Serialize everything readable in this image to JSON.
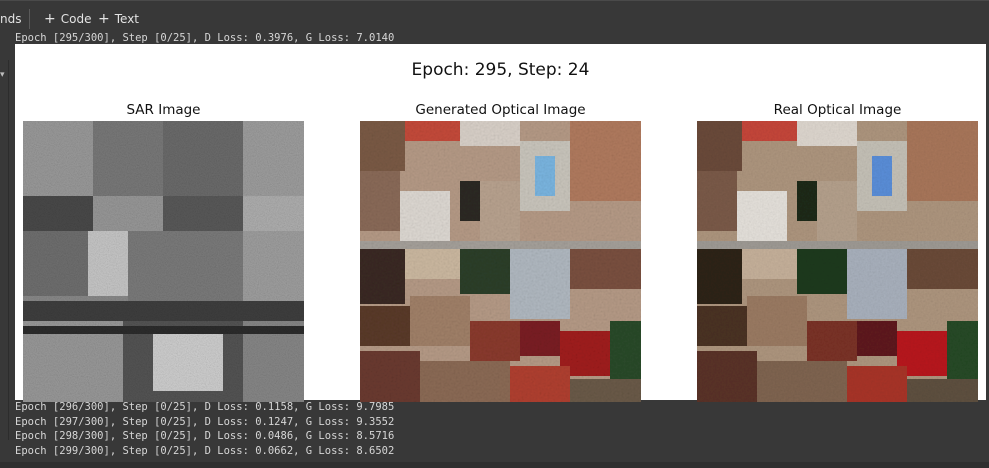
{
  "toolbar": {
    "left_label": "nds",
    "code_label": "Code",
    "text_label": "Text"
  },
  "output": {
    "log_top": "Epoch [295/300], Step [0/25], D Loss: 0.3976, G Loss: 7.0140",
    "figure": {
      "title": "Epoch: 295, Step: 24",
      "panels": [
        {
          "title": "SAR Image"
        },
        {
          "title": "Generated Optical Image"
        },
        {
          "title": "Real Optical Image"
        }
      ]
    },
    "log_bottom": [
      "Epoch [296/300], Step [0/25], D Loss: 0.1158, G Loss: 9.7985",
      "Epoch [297/300], Step [0/25], D Loss: 0.1247, G Loss: 9.3552",
      "Epoch [298/300], Step [0/25], D Loss: 0.0486, G Loss: 8.5716",
      "Epoch [299/300], Step [0/25], D Loss: 0.0662, G Loss: 8.6502"
    ]
  },
  "colors": {
    "background": "#383838",
    "figure_bg": "#ffffff",
    "log_text": "#d6d6d6"
  },
  "icons": {
    "add_code": "plus-icon",
    "add_text": "plus-icon",
    "gutter": "caret-down-icon"
  }
}
